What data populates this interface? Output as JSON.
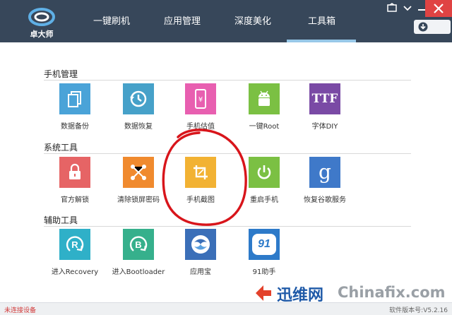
{
  "app": {
    "logo_text": "卓大师"
  },
  "nav": {
    "tabs": [
      {
        "label": "一键刷机"
      },
      {
        "label": "应用管理"
      },
      {
        "label": "深度美化"
      },
      {
        "label": "工具箱"
      }
    ],
    "active_tab": "工具箱"
  },
  "sections": [
    {
      "title": "手机管理",
      "tools": [
        {
          "label": "数据备份",
          "color": "#4aa3d8",
          "icon": "files-icon"
        },
        {
          "label": "数据恢复",
          "color": "#46a1c9",
          "icon": "history-icon"
        },
        {
          "label": "手机估值",
          "color": "#e85fb0",
          "icon": "phone-yen-icon"
        },
        {
          "label": "一键Root",
          "color": "#7bc043",
          "icon": "android-root-icon"
        },
        {
          "label": "字体DIY",
          "color": "#7a4aa5",
          "icon": "ttf-icon",
          "icon_text": "TTF"
        }
      ]
    },
    {
      "title": "系统工具",
      "tools": [
        {
          "label": "官方解锁",
          "color": "#e66465",
          "icon": "lock-icon"
        },
        {
          "label": "清除锁屏密码",
          "color": "#f08a2e",
          "icon": "pattern-icon"
        },
        {
          "label": "手机截图",
          "color": "#f2b233",
          "icon": "crop-icon"
        },
        {
          "label": "重启手机",
          "color": "#7bc043",
          "icon": "power-icon"
        },
        {
          "label": "恢复谷歌服务",
          "color": "#3f79c9",
          "icon": "google-icon",
          "icon_text": "g"
        }
      ]
    },
    {
      "title": "辅助工具",
      "tools": [
        {
          "label": "进入Recovery",
          "color": "#2fb0c8",
          "icon": "recovery-icon",
          "icon_text": "R"
        },
        {
          "label": "进入Bootloader",
          "color": "#36b08c",
          "icon": "bootloader-icon",
          "icon_text": "B"
        },
        {
          "label": "应用宝",
          "color": "#3b6fb8",
          "icon": "yingyongbao-icon"
        },
        {
          "label": "91助手",
          "color": "#2d7ac9",
          "icon": "91-assistant-icon",
          "icon_text": "91"
        }
      ]
    }
  ],
  "status": {
    "left": "未连接设备",
    "right": "软件版本号:V5.2.16"
  },
  "watermark": {
    "text1": "迅维网",
    "text2": "Chinafix.com"
  }
}
